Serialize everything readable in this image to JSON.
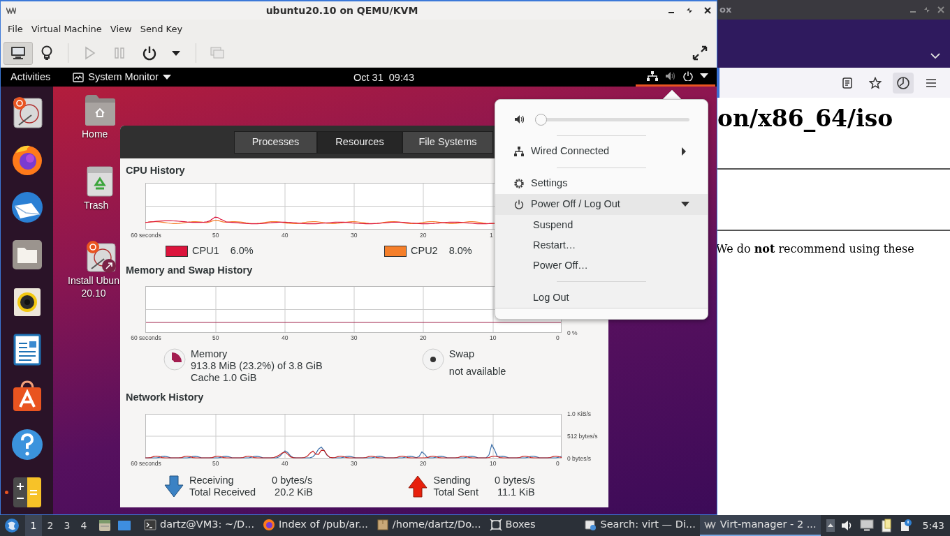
{
  "browser_window": {
    "title": "ox",
    "heading": "on/x86_64/iso",
    "paragraph": "We do **not** recommend using these"
  },
  "vm_window": {
    "title": "ubuntu20.10 on QEMU/KVM",
    "menu": [
      "File",
      "Virtual Machine",
      "View",
      "Send Key"
    ],
    "toolbar": [
      {
        "kind": "console",
        "selected": true,
        "disabled": false
      },
      {
        "kind": "details",
        "selected": false,
        "disabled": false
      },
      {
        "kind": "separator"
      },
      {
        "kind": "run",
        "selected": false,
        "disabled": true
      },
      {
        "kind": "pause",
        "selected": false,
        "disabled": true
      },
      {
        "kind": "shutdown",
        "selected": false,
        "disabled": false
      },
      {
        "kind": "dropdown",
        "selected": false,
        "disabled": false
      },
      {
        "kind": "separator"
      },
      {
        "kind": "screenshots",
        "selected": false,
        "disabled": true
      },
      {
        "kind": "fullscreen",
        "selected": false,
        "disabled": false
      }
    ]
  },
  "guest": {
    "top_bar": {
      "activities": "Activities",
      "app_menu": "System Monitor",
      "clock": "Oct 31  09:43",
      "system_menu_open": true
    },
    "dock": [
      {
        "kind": "installer",
        "running": false
      },
      {
        "kind": "firefox",
        "running": false
      },
      {
        "kind": "mail",
        "running": false
      },
      {
        "kind": "files",
        "running": false
      },
      {
        "kind": "music",
        "running": false
      },
      {
        "kind": "writer",
        "running": false
      },
      {
        "kind": "software",
        "running": false
      },
      {
        "kind": "help",
        "running": false
      },
      {
        "kind": "calculator",
        "running": true
      }
    ],
    "desktop_icons": [
      {
        "kind": "home",
        "label": "Home"
      },
      {
        "kind": "trash",
        "label": "Trash"
      },
      {
        "kind": "installer",
        "label": "Install Ubun\n20.10"
      }
    ]
  },
  "system_monitor": {
    "tabs": [
      {
        "label": "Processes",
        "selected": false
      },
      {
        "label": "Resources",
        "selected": true
      },
      {
        "label": "File Systems",
        "selected": false
      }
    ],
    "cpu": {
      "title": "CPU History",
      "x_labels": [
        "60 seconds",
        "50",
        "40",
        "30",
        "20",
        "1"
      ],
      "legend": [
        {
          "name": "CPU1",
          "value": "6.0%",
          "color": "#dc143c"
        },
        {
          "name": "CPU2",
          "value": "8.0%",
          "color": "#f57f2a"
        }
      ]
    },
    "memory": {
      "title": "Memory and Swap History",
      "x_labels": [
        "60 seconds",
        "50",
        "40",
        "30",
        "20",
        "10",
        "0"
      ],
      "y_labels": [
        "0 %"
      ],
      "memory": {
        "label": "Memory",
        "lines": [
          "913.8 MiB (23.2%) of 3.8 GiB",
          "Cache 1.0 GiB"
        ]
      },
      "swap": {
        "label": "Swap",
        "lines": [
          "not available"
        ]
      }
    },
    "network": {
      "title": "Network History",
      "x_labels": [
        "60 seconds",
        "50",
        "40",
        "30",
        "20",
        "10",
        "0"
      ],
      "y_labels": [
        "1.0 KiB/s",
        "512 bytes/s",
        "0 bytes/s"
      ],
      "receiving": {
        "label": "Receiving",
        "value": "0 bytes/s",
        "total_label": "Total Received",
        "total": "20.2 KiB"
      },
      "sending": {
        "label": "Sending",
        "value": "0 bytes/s",
        "total_label": "Total Sent",
        "total": "11.1 KiB"
      }
    }
  },
  "system_menu": {
    "items": [
      {
        "kind": "volume",
        "level": 0
      },
      {
        "kind": "separator"
      },
      {
        "kind": "network",
        "label": "Wired Connected"
      },
      {
        "kind": "separator"
      },
      {
        "kind": "settings",
        "label": "Settings"
      },
      {
        "kind": "power",
        "label": "Power Off / Log Out",
        "expanded": true,
        "children": [
          {
            "kind": "action",
            "label": "Suspend"
          },
          {
            "kind": "action",
            "label": "Restart…"
          },
          {
            "kind": "action",
            "label": "Power Off…"
          },
          {
            "kind": "separator"
          },
          {
            "kind": "action",
            "label": "Log Out"
          }
        ]
      }
    ]
  },
  "taskbar": {
    "workspaces": [
      {
        "label": "1",
        "selected": true
      },
      {
        "label": "2",
        "selected": false
      },
      {
        "label": "3",
        "selected": false
      },
      {
        "label": "4",
        "selected": false
      }
    ],
    "launchers": [
      {
        "kind": "files"
      },
      {
        "kind": "desktop"
      }
    ],
    "tasks": [
      {
        "kind": "terminal",
        "label": "dartz@VM3: ~/D...",
        "selected": false
      },
      {
        "kind": "firefox",
        "label": "Index of /pub/ar...",
        "selected": false
      },
      {
        "kind": "folder",
        "label": "/home/dartz/Do...",
        "selected": false
      },
      {
        "kind": "boxes",
        "label": "Boxes",
        "selected": false
      },
      {
        "kind": "search",
        "label": "Search: virt — Di...",
        "selected": false
      },
      {
        "kind": "virt",
        "label": "Virt-manager - 2 ...",
        "selected": true
      }
    ],
    "tray": [
      {
        "kind": "scroll"
      },
      {
        "kind": "volume"
      },
      {
        "kind": "display"
      },
      {
        "kind": "clipboard"
      },
      {
        "kind": "notify"
      }
    ],
    "clock": "5:43"
  }
}
